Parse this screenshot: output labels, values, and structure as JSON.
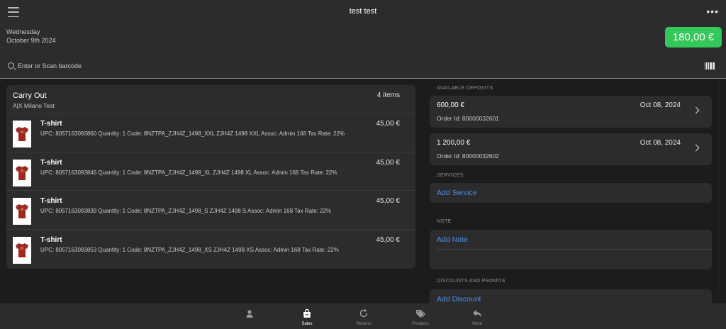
{
  "header": {
    "title": "test test",
    "more_icon": "more-dots-icon",
    "menu_icon": "hamburger-menu-icon",
    "date_line1": "Wednesday",
    "date_line2": "October 9th 2024",
    "total": "180,00 €",
    "total_color": "#34c759"
  },
  "search": {
    "placeholder": "Enter or Scan barcode",
    "icon": "search-icon",
    "barcode_icon": "barcode-icon"
  },
  "cart": {
    "title": "Carry Out",
    "subtitle": "A|X Milano Test",
    "count": "4 items",
    "items": [
      {
        "name": "T-shirt",
        "desc": "UPC: 8057163093860 Quantity: 1 Code: 8NZTPA_ZJH4Z_1498_XXL ZJH4Z 1498 XXL Assoc: Admin 168 Tax Rate: 22%",
        "price": "45,00 €"
      },
      {
        "name": "T-shirt",
        "desc": "UPC: 8057163093846 Quantity: 1 Code: 8NZTPA_ZJH4Z_1498_XL ZJH4Z 1498 XL Assoc: Admin 168 Tax Rate: 22%",
        "price": "45,00 €"
      },
      {
        "name": "T-shirt",
        "desc": "UPC: 8057163093839 Quantity: 1 Code: 8NZTPA_ZJH4Z_1498_S ZJH4Z 1498 S Assoc: Admin 168 Tax Rate: 22%",
        "price": "45,00 €"
      },
      {
        "name": "T-shirt",
        "desc": "UPC: 8057163093853 Quantity: 1 Code: 8NZTPA_ZJH4Z_1498_XS ZJH4Z 1498 XS Assoc: Admin 168 Tax Rate: 22%",
        "price": "45,00 €"
      }
    ]
  },
  "deposits": {
    "label": "AVAILABLE DEPOSITS",
    "items": [
      {
        "amount": "600,00 €",
        "date": "Oct 08, 2024",
        "order": "Order Id: 80000032601"
      },
      {
        "amount": "1 200,00 €",
        "date": "Oct 08, 2024",
        "order": "Order Id: 80000032602"
      }
    ]
  },
  "services": {
    "label": "SERVICES",
    "action": "Add Service"
  },
  "note": {
    "label": "NOTE",
    "action": "Add Note"
  },
  "discounts": {
    "label": "DISCOUNTS AND PROMOS",
    "action": "Add Discount"
  },
  "link_color": "#4a90e2",
  "tabs": [
    {
      "label": "",
      "icon": "customer-icon"
    },
    {
      "label": "Sales",
      "icon": "shopping-bag-icon"
    },
    {
      "label": "Returns",
      "icon": "refresh-icon"
    },
    {
      "label": "Products",
      "icon": "tags-icon"
    },
    {
      "label": "More",
      "icon": "reply-icon"
    }
  ]
}
